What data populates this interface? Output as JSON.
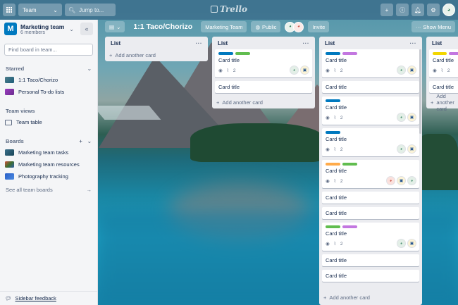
{
  "header": {
    "apps_icon": "grid-icon",
    "team_label": "Team",
    "search_placeholder": "Jump to...",
    "logo_text": "Trello",
    "right_icons": [
      "plus-icon",
      "info-icon",
      "bell-icon",
      "gear-icon"
    ]
  },
  "sidebar": {
    "team_initial": "M",
    "team_name": "Marketing team",
    "team_members": "6 members",
    "search_placeholder": "Find board in team...",
    "starred_title": "Starred",
    "starred": [
      {
        "label": "1:1 Taco/Chorizo"
      },
      {
        "label": "Personal To-do lists"
      }
    ],
    "team_views_title": "Team views",
    "team_views": [
      {
        "label": "Team table"
      }
    ],
    "boards_title": "Boards",
    "boards": [
      {
        "label": "Marketing team tasks"
      },
      {
        "label": "Marketing team resources"
      },
      {
        "label": "Photography tracking"
      }
    ],
    "see_all": "See all team boards",
    "feedback": "Sidebar feedback"
  },
  "board": {
    "title": "1:1 Taco/Chorizo",
    "team_button": "Marketing Team",
    "visibility": "Public",
    "invite": "Invite",
    "show_menu": "Show Menu"
  },
  "lists": [
    {
      "title": "List",
      "add_label": "Add another card",
      "cards": []
    },
    {
      "title": "List",
      "add_label": "Add another card",
      "cards": [
        {
          "title": "Card title",
          "labels": [
            "#0079bf",
            "#61bd4f"
          ],
          "attachments": "2",
          "members": [
            "g",
            "y"
          ]
        },
        {
          "title": "Card title"
        }
      ]
    },
    {
      "title": "List",
      "add_label": "Add another card",
      "cards": [
        {
          "title": "Card title",
          "labels": [
            "#0079bf",
            "#c377e0"
          ],
          "attachments": "2",
          "members": [
            "g",
            "y"
          ]
        },
        {
          "title": "Card title"
        },
        {
          "title": "Card title",
          "labels": [
            "#0079bf"
          ],
          "attachments": "2",
          "members": [
            "g",
            "y"
          ]
        },
        {
          "title": "Card title",
          "labels": [
            "#0079bf"
          ],
          "attachments": "2",
          "members": [
            "g",
            "y"
          ]
        },
        {
          "title": "Card title",
          "labels": [
            "#ffab4a",
            "#61bd4f"
          ],
          "attachments": "2",
          "members": [
            "r",
            "y",
            "g"
          ]
        },
        {
          "title": "Card title"
        },
        {
          "title": "Card title"
        },
        {
          "title": "Card title",
          "labels": [
            "#61bd4f",
            "#c377e0"
          ],
          "attachments": "2",
          "members": [
            "g",
            "y"
          ]
        },
        {
          "title": "Card title"
        },
        {
          "title": "Card title"
        }
      ]
    },
    {
      "title": "List",
      "add_label": "Add another card",
      "cards": [
        {
          "title": "Card title",
          "labels": [
            "#f2d600",
            "#c377e0"
          ],
          "attachments": "2",
          "members": [
            "g"
          ]
        },
        {
          "title": "Card title"
        }
      ]
    }
  ],
  "colors": {
    "accent": "#0079bf",
    "sidebar_bg": "#f4f5f7",
    "list_bg": "#ebecf0"
  }
}
